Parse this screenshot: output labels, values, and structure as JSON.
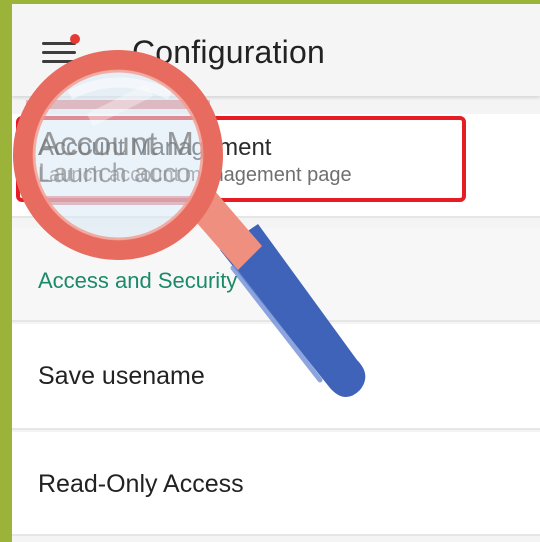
{
  "app_bar": {
    "title": "Configuration",
    "menu_icon": "hamburger-menu-icon",
    "notification_dot_color": "#e53935"
  },
  "account_management": {
    "title": "Account Management",
    "subtitle": "Launch account management page",
    "highlight_color": "#e51c23"
  },
  "sections": {
    "access_security_header": "Access and Security"
  },
  "settings": {
    "save_username_label": "Save usename",
    "read_only_label": "Read-Only Access"
  },
  "overlay": {
    "icon": "magnifying-glass-icon",
    "lens_rim_color": "#e76b5f",
    "handle_color": "#3f63b8"
  },
  "colors": {
    "frame": "#9cb33a",
    "accent": "#1b8a6b"
  }
}
